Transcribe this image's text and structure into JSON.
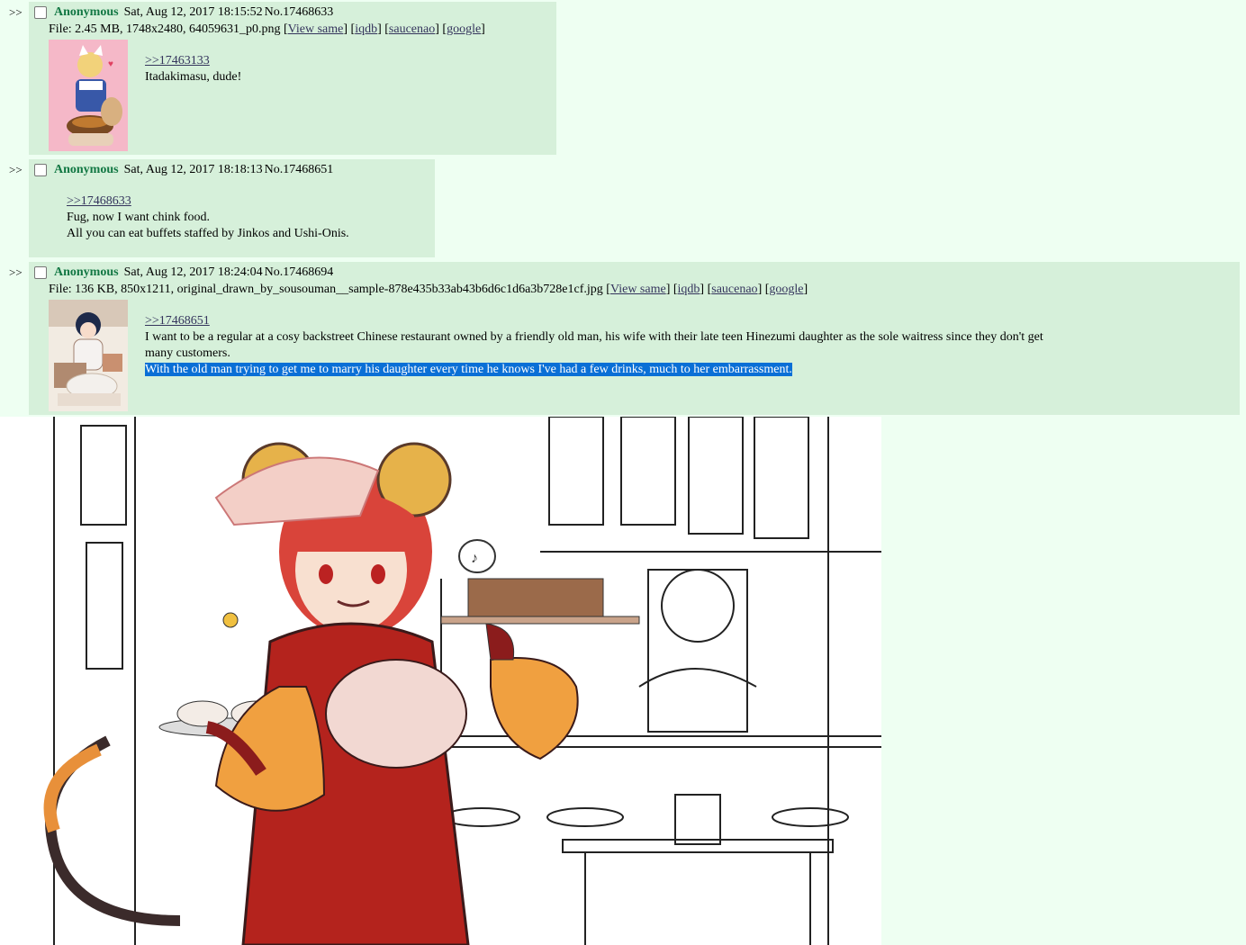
{
  "thread": {
    "arrow": ">>",
    "posts": [
      {
        "name": "Anonymous",
        "datetime": "Sat, Aug 12, 2017 18:15:52",
        "number": "No.17468633",
        "file_prefix": "File: 2.45 MB, 1748x2480, 64059631_p0.png [",
        "links": [
          "View same",
          "iqdb",
          "saucenao",
          "google"
        ],
        "quote": ">>17463133",
        "lines": [
          "Itadakimasu, dude!"
        ]
      },
      {
        "name": "Anonymous",
        "datetime": "Sat, Aug 12, 2017 18:18:13",
        "number": "No.17468651",
        "quote": ">>17468633",
        "lines": [
          "Fug, now I want chink food.",
          "All you can eat buffets staffed by Jinkos and Ushi-Onis."
        ]
      },
      {
        "name": "Anonymous",
        "datetime": "Sat, Aug 12, 2017 18:24:04",
        "number": "No.17468694",
        "file_prefix": "File: 136 KB, 850x1211, original_drawn_by_sousouman__sample-878e435b33ab43b6d6c1d6a3b728e1cf.jpg [",
        "links": [
          "View same",
          "iqdb",
          "saucenao",
          "google"
        ],
        "quote": ">>17468651",
        "lines": [
          "I want to be a regular at a cosy backstreet Chinese restaurant owned by a friendly old man, his wife with their late teen Hinezumi daughter as the sole waitress since they don't get",
          "many customers.",
          "With the old man trying to get me to marry his daughter every time he knows I've had a few drinks, much to her embarrassment."
        ]
      }
    ]
  },
  "colors": {
    "reply_bg": "#d6f0da",
    "page_bg": "#eefff2",
    "name": "#117743",
    "highlight": "#0a6fd6"
  }
}
